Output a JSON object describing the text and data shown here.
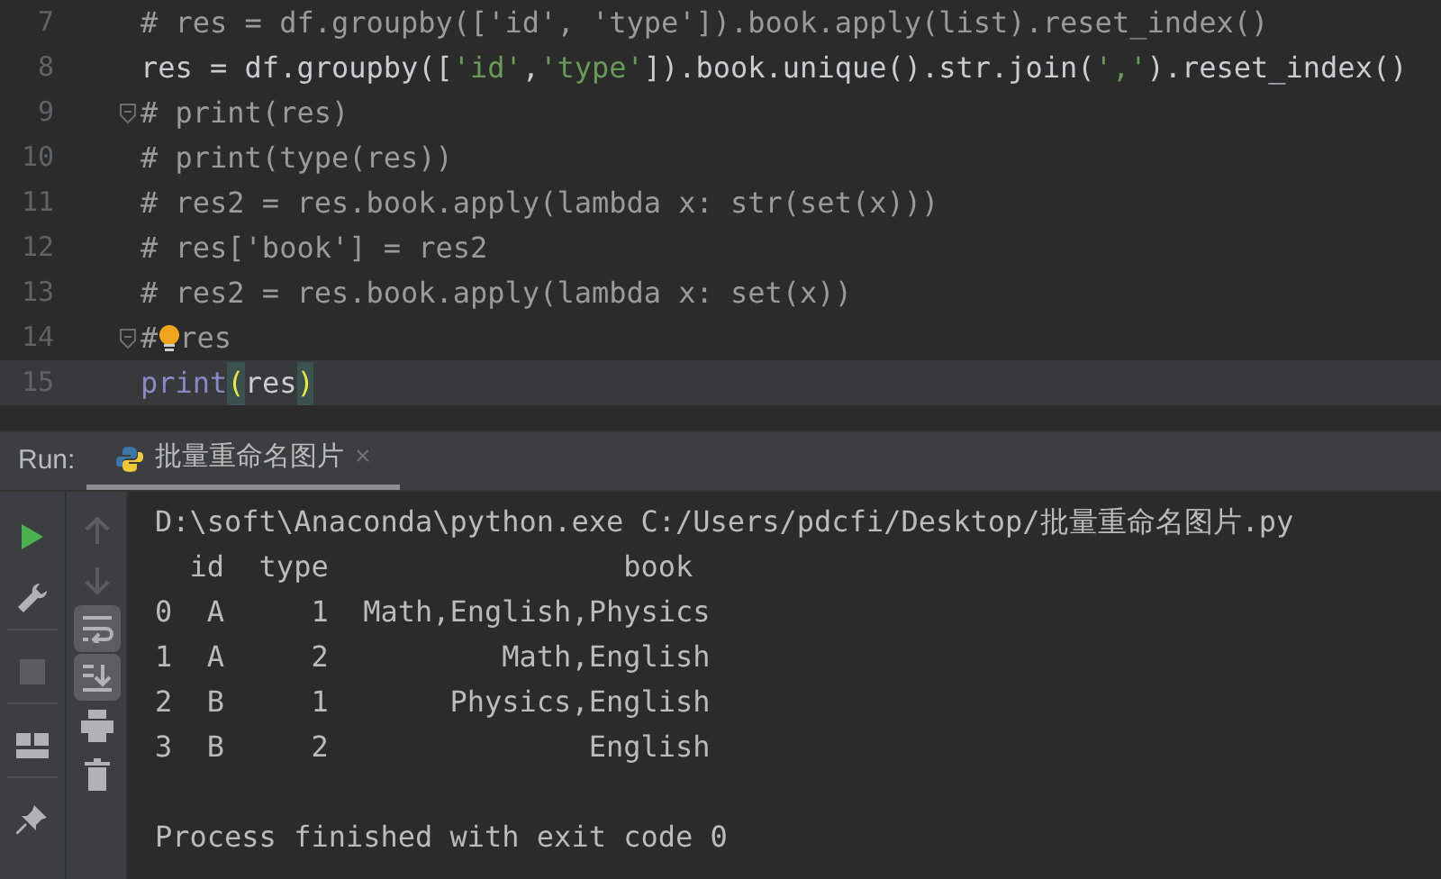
{
  "editor": {
    "lines": [
      {
        "number": "7",
        "current": false,
        "fold": false,
        "bulb": false,
        "segments": [
          {
            "kind": "comment",
            "text": "# res = df.groupby(['id', 'type']).book.apply(list).reset_index()"
          }
        ]
      },
      {
        "number": "8",
        "current": false,
        "fold": false,
        "bulb": false,
        "segments": [
          {
            "kind": "plain",
            "text": "res = df.groupby(["
          },
          {
            "kind": "string",
            "text": "'id'"
          },
          {
            "kind": "plain",
            "text": ","
          },
          {
            "kind": "string",
            "text": "'type'"
          },
          {
            "kind": "plain",
            "text": "]).book.unique().str.join("
          },
          {
            "kind": "string",
            "text": "','"
          },
          {
            "kind": "plain",
            "text": ").reset_index()"
          }
        ]
      },
      {
        "number": "9",
        "current": false,
        "fold": true,
        "bulb": false,
        "segments": [
          {
            "kind": "comment",
            "text": "# print(res)"
          }
        ]
      },
      {
        "number": "10",
        "current": false,
        "fold": false,
        "bulb": false,
        "segments": [
          {
            "kind": "comment",
            "text": "# print(type(res))"
          }
        ]
      },
      {
        "number": "11",
        "current": false,
        "fold": false,
        "bulb": false,
        "segments": [
          {
            "kind": "comment",
            "text": "# res2 = res.book.apply(lambda x: str(set(x)))"
          }
        ]
      },
      {
        "number": "12",
        "current": false,
        "fold": false,
        "bulb": false,
        "segments": [
          {
            "kind": "comment",
            "text": "# res['book'] = res2"
          }
        ]
      },
      {
        "number": "13",
        "current": false,
        "fold": false,
        "bulb": false,
        "segments": [
          {
            "kind": "comment",
            "text": "# res2 = res.book.apply(lambda x: set(x))"
          }
        ]
      },
      {
        "number": "14",
        "current": false,
        "fold": true,
        "bulb": true,
        "segments": [
          {
            "kind": "comment",
            "text": "#"
          },
          {
            "kind": "comment",
            "text": "res"
          }
        ]
      },
      {
        "number": "15",
        "current": true,
        "fold": false,
        "bulb": false,
        "segments": [
          {
            "kind": "builtin",
            "text": "print"
          },
          {
            "kind": "brace",
            "text": "("
          },
          {
            "kind": "plain",
            "text": "res"
          },
          {
            "kind": "brace",
            "text": ")"
          }
        ]
      }
    ]
  },
  "run_panel": {
    "label": "Run:",
    "tabs": [
      {
        "title": "批量重命名图片",
        "close": "×",
        "selected": true
      }
    ],
    "toolbar_left": [
      {
        "kind": "run",
        "disabled": false
      },
      {
        "kind": "wrench",
        "disabled": false
      },
      {
        "kind": "stop",
        "disabled": true
      },
      {
        "kind": "layout",
        "disabled": false
      },
      {
        "kind": "pin",
        "disabled": false
      }
    ],
    "toolbar_right": [
      {
        "kind": "up",
        "disabled": true,
        "active": false
      },
      {
        "kind": "down",
        "disabled": true,
        "active": false
      },
      {
        "kind": "wrap",
        "disabled": false,
        "active": true
      },
      {
        "kind": "scroll",
        "disabled": false,
        "active": true
      },
      {
        "kind": "print",
        "disabled": false,
        "active": false
      },
      {
        "kind": "trash",
        "disabled": false,
        "active": false
      }
    ],
    "output": [
      "D:\\soft\\Anaconda\\python.exe C:/Users/pdcfi/Desktop/批量重命名图片.py",
      "  id  type                 book",
      "0  A     1  Math,English,Physics",
      "1  A     2          Math,English",
      "2  B     1       Physics,English",
      "3  B     2               English"
    ],
    "exit_message": "Process finished with exit code 0"
  }
}
